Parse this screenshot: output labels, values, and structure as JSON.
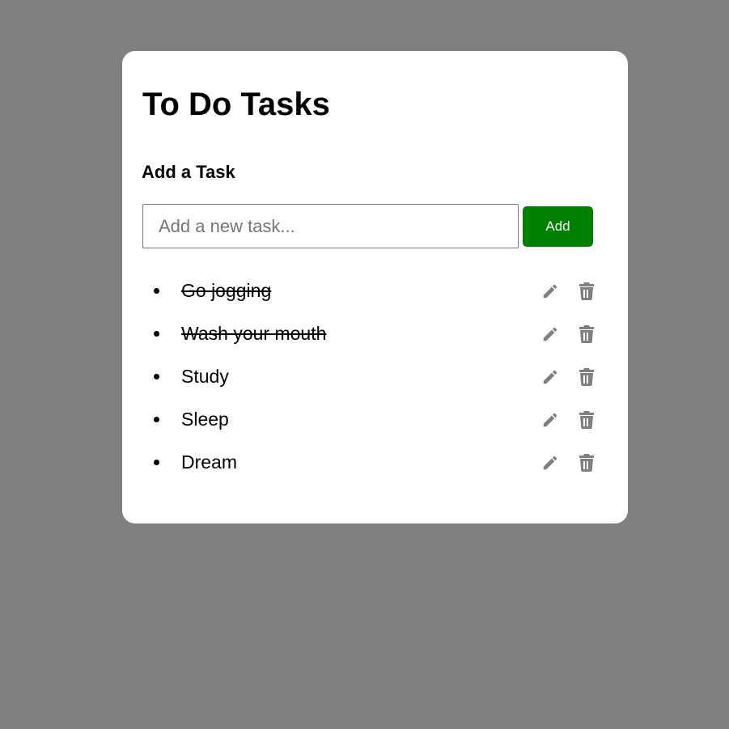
{
  "app": {
    "title": "To Do Tasks",
    "subtitle": "Add a Task"
  },
  "form": {
    "placeholder": "Add a new task...",
    "value": "",
    "add_label": "Add"
  },
  "tasks": [
    {
      "label": "Go jogging",
      "completed": true
    },
    {
      "label": "Wash your mouth",
      "completed": true
    },
    {
      "label": "Study",
      "completed": false
    },
    {
      "label": "Sleep",
      "completed": false
    },
    {
      "label": "Dream",
      "completed": false
    }
  ],
  "icons": {
    "edit": "pencil-icon",
    "delete": "trash-icon"
  },
  "colors": {
    "background": "#808080",
    "card": "#ffffff",
    "accent": "#008000",
    "icon": "#808080"
  }
}
